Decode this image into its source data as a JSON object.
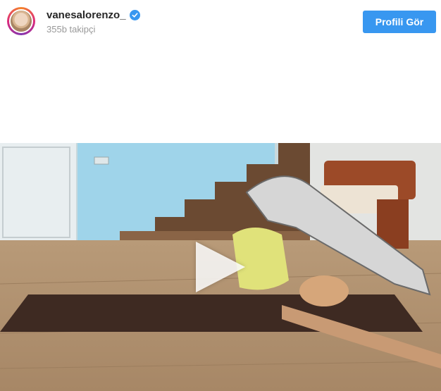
{
  "post_header": {
    "username": "vanesalorenzo_",
    "followers": "355b takipçi",
    "profile_button_label": "Profili Gör",
    "verified_icon": "verified-check-icon"
  },
  "media": {
    "type": "video",
    "play_icon": "play-icon"
  },
  "colors": {
    "accent": "#3897f0",
    "username": "#262626",
    "secondary_text": "#999999"
  }
}
